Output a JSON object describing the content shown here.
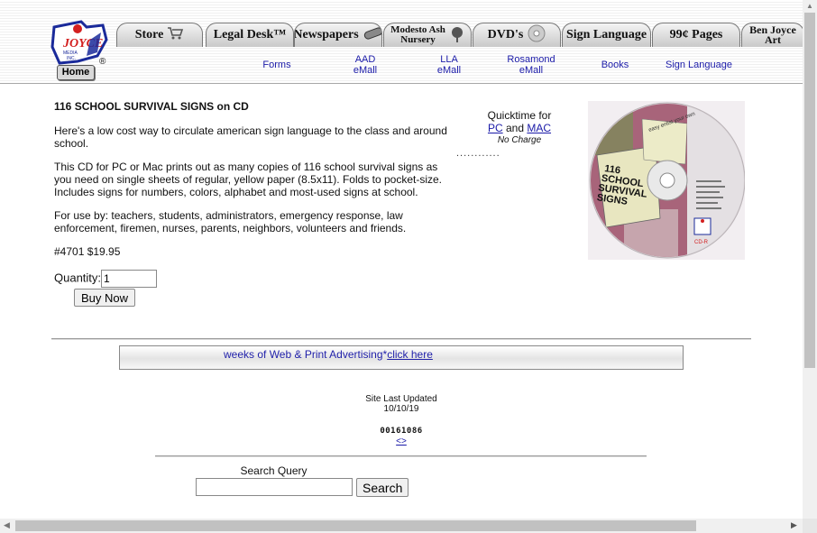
{
  "logo": {
    "brand_text": "JOYCE MEDIA INC.",
    "home_label": "Home",
    "registered": "®"
  },
  "tabs": [
    {
      "label": "Store",
      "icon": "shopping-cart-icon"
    },
    {
      "label": "Legal Desk™",
      "icon": ""
    },
    {
      "label": "Newspapers",
      "icon": "newspaper-roll-icon"
    },
    {
      "label_line1": "Modesto Ash",
      "label_line2": "Nursery",
      "icon": "tree-icon"
    },
    {
      "label": "DVD's",
      "icon": "disc-icon"
    },
    {
      "label": "Sign Language",
      "icon": ""
    },
    {
      "label": "99¢ Pages",
      "icon": ""
    },
    {
      "label_line1": "Ben Joyce",
      "label_line2": "Art",
      "icon": ""
    }
  ],
  "subnav": [
    {
      "line1": "Forms",
      "line2": ""
    },
    {
      "line1": "AAD",
      "line2": "eMall"
    },
    {
      "line1": "LLA",
      "line2": "eMall"
    },
    {
      "line1": "Rosamond",
      "line2": "eMall"
    },
    {
      "line1": "Books",
      "line2": ""
    },
    {
      "line1": "Sign Language",
      "line2": ""
    }
  ],
  "product": {
    "title": "116 SCHOOL SURVIVAL SIGNS on CD",
    "para1": "Here's a low cost way to circulate american sign language to the class and around school.",
    "para2": "This CD for PC or Mac prints out as many copies of 116 school survival signs as you need on single sheets of regular, yellow paper (8.5x11). Folds to pocket-size. Includes signs for numbers, colors, alphabet and most-used signs at school.",
    "para3": "For use by: teachers, students, administrators, emergency response, law enforcement, firemen, nurses, parents, neighbors, volunteers and friends.",
    "price": "#4701 $19.95",
    "quantity_label": "Quantity:",
    "quantity_value": "1",
    "buy_label": "Buy Now"
  },
  "quicktime": {
    "line1": "Quicktime for",
    "pc": "PC",
    "and": "and",
    "mac": "MAC",
    "no_charge": "No Charge",
    "dots": "............"
  },
  "cd_image": {
    "title_lines": [
      "116",
      "SCHOOL",
      "SURVIVAL",
      "SIGNS"
    ],
    "small_text": "easy enlist your own",
    "label": "CD-R"
  },
  "ad": {
    "text": "weeks of Web & Print Advertising*",
    "link": "click here"
  },
  "footer": {
    "updated_line1": "Site Last Updated",
    "updated_line2": "10/10/19",
    "counter": "00161086",
    "counter_link": "<>",
    "search_label": "Search Query",
    "search_value": "",
    "search_button": "Search"
  },
  "colors": {
    "link": "#1a1aa8",
    "logo_red": "#d32020",
    "logo_blue": "#1a2a9a"
  }
}
